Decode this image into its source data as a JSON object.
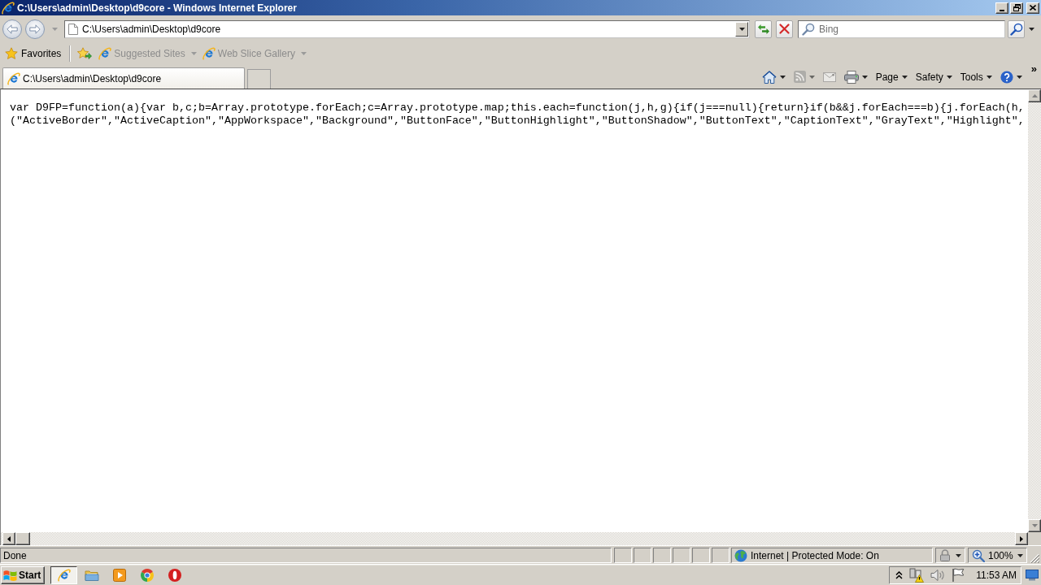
{
  "window": {
    "title": "C:\\Users\\admin\\Desktop\\d9core - Windows Internet Explorer"
  },
  "address_bar": {
    "value": "C:\\Users\\admin\\Desktop\\d9core"
  },
  "search": {
    "placeholder": "Bing"
  },
  "favorites_bar": {
    "favorites": "Favorites",
    "links": [
      {
        "label": "Suggested Sites",
        "disabled": true
      },
      {
        "label": "Web Slice Gallery",
        "disabled": true
      }
    ]
  },
  "tabs": [
    {
      "label": "C:\\Users\\admin\\Desktop\\d9core",
      "selected": true
    }
  ],
  "command_bar": {
    "items": [
      {
        "kind": "home",
        "disabled": false
      },
      {
        "kind": "feeds",
        "disabled": true
      },
      {
        "kind": "mail",
        "disabled": true
      },
      {
        "kind": "print",
        "disabled": false
      },
      {
        "kind": "menu",
        "label": "Page"
      },
      {
        "kind": "menu",
        "label": "Safety"
      },
      {
        "kind": "menu",
        "label": "Tools"
      },
      {
        "kind": "help",
        "disabled": false
      }
    ],
    "more": "»"
  },
  "document": {
    "lines": [
      "var D9FP=function(a){var b,c;b=Array.prototype.forEach;c=Array.prototype.map;this.each=function(j,h,g){if(j===null){return}if(b&&j.forEach===b){j.forEach(h,",
      "(\"ActiveBorder\",\"ActiveCaption\",\"AppWorkspace\",\"Background\",\"ButtonFace\",\"ButtonHighlight\",\"ButtonShadow\",\"ButtonText\",\"CaptionText\",\"GrayText\",\"Highlight\","
    ]
  },
  "status_bar": {
    "text": "Done",
    "zone": "Internet | Protected Mode: On",
    "zoom": "100%"
  },
  "taskbar": {
    "start": "Start",
    "apps": [
      {
        "kind": "browser",
        "selected": true
      },
      {
        "kind": "folder",
        "selected": false
      },
      {
        "kind": "media",
        "selected": false
      },
      {
        "kind": "chrome",
        "selected": false
      },
      {
        "kind": "opera",
        "selected": false
      }
    ],
    "clock": "11:53 AM"
  }
}
